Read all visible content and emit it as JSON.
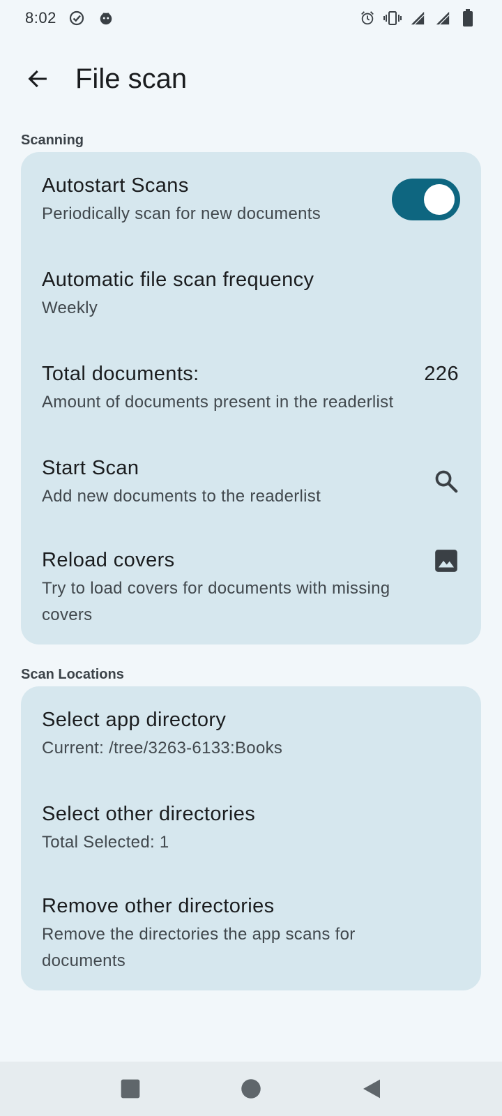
{
  "status_bar": {
    "time": "8:02",
    "left_icons": [
      "check-circle-icon",
      "notification-app-icon"
    ],
    "right_icons": [
      "alarm-icon",
      "vibrate-icon",
      "signal-icon",
      "signal-icon",
      "battery-icon"
    ]
  },
  "app_bar": {
    "back_icon": "arrow-back-icon",
    "title": "File scan"
  },
  "sections": {
    "scanning": {
      "label": "Scanning",
      "items": {
        "autostart": {
          "title": "Autostart Scans",
          "subtitle": "Periodically scan for new documents",
          "toggle_on": true
        },
        "frequency": {
          "title": "Automatic file scan frequency",
          "subtitle": "Weekly"
        },
        "total": {
          "title": "Total documents:",
          "value": "226",
          "subtitle": "Amount of documents present in the readerlist"
        },
        "start_scan": {
          "title": "Start Scan",
          "subtitle": "Add new documents to the readerlist",
          "icon": "search-icon"
        },
        "reload_covers": {
          "title": "Reload covers",
          "subtitle": "Try to load covers for documents with missing covers",
          "icon": "image-icon"
        }
      }
    },
    "scan_locations": {
      "label": "Scan Locations",
      "items": {
        "app_directory": {
          "title": "Select app directory",
          "subtitle": "Current: /tree/3263-6133:Books"
        },
        "other_directories": {
          "title": "Select other directories",
          "subtitle": "Total Selected: 1"
        },
        "remove_directories": {
          "title": "Remove other directories",
          "subtitle": "Remove the directories the app scans for documents"
        }
      }
    }
  },
  "nav_bar": {
    "buttons": [
      "recents-square-icon",
      "home-circle-icon",
      "back-triangle-icon"
    ]
  },
  "colors": {
    "background": "#f2f7fa",
    "card": "#d6e7ee",
    "accent": "#0e6680",
    "nav_bar": "#e6ecef"
  }
}
